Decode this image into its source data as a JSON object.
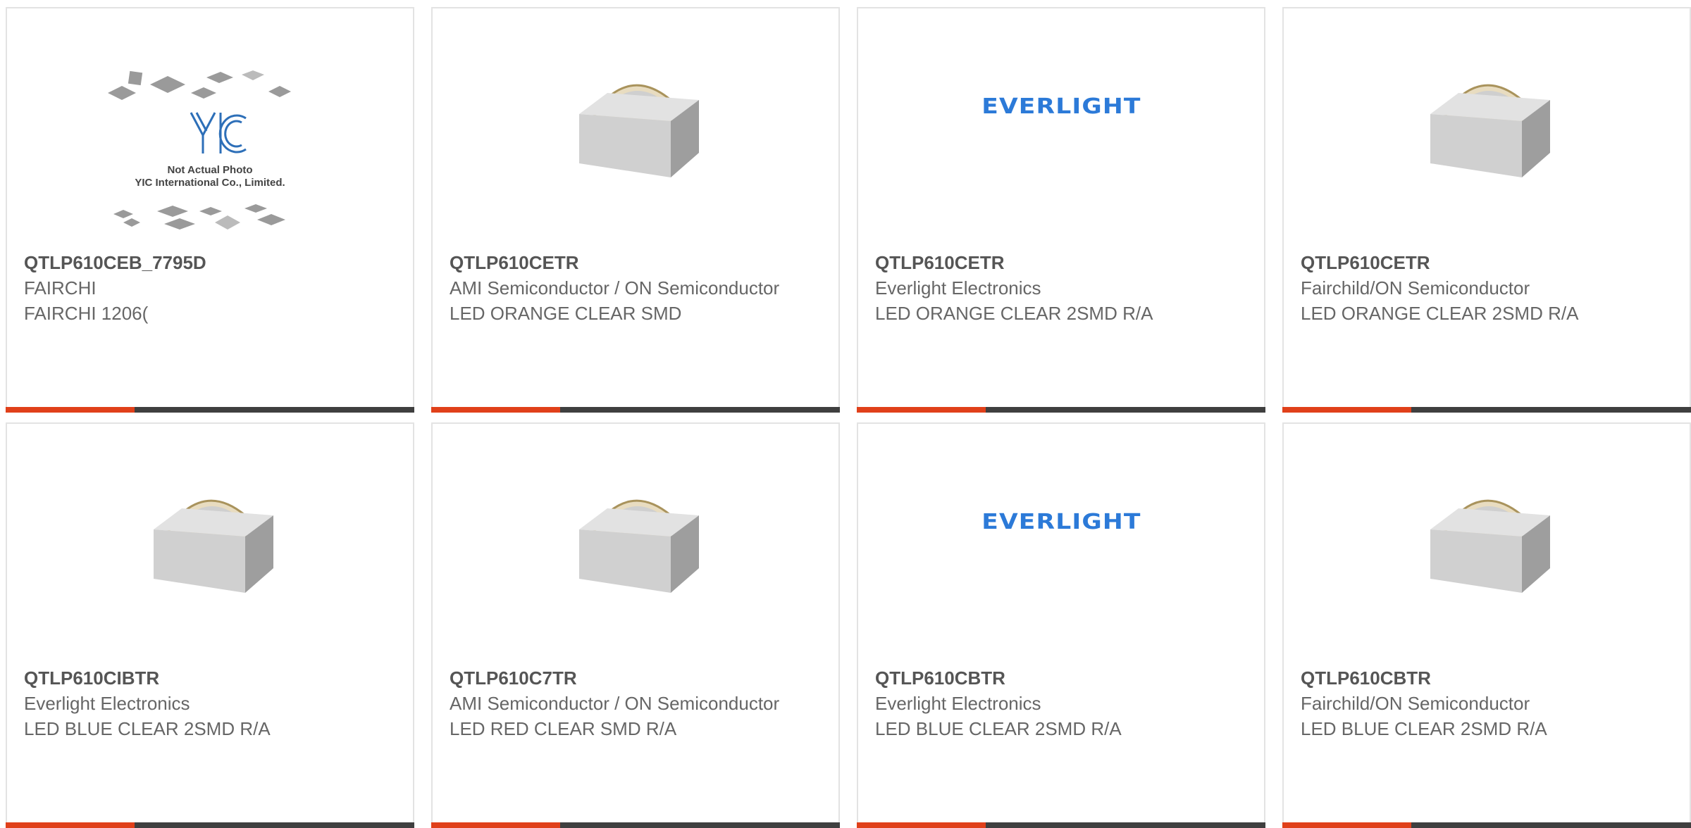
{
  "products": [
    {
      "part": "QTLP610CEB_7795D",
      "manufacturer": "FAIRCHI",
      "description": "FAIRCHI 1206(",
      "image": "yic-placeholder",
      "image_text": {
        "line1": "Not Actual Photo",
        "line2": "YIC International Co., Limited.",
        "logo": "YIC"
      }
    },
    {
      "part": "QTLP610CETR",
      "manufacturer": "AMI Semiconductor / ON Semiconductor",
      "description": "LED ORANGE CLEAR SMD",
      "image": "led-photo"
    },
    {
      "part": "QTLP610CETR",
      "manufacturer": "Everlight Electronics",
      "description": "LED ORANGE CLEAR 2SMD R/A",
      "image": "everlight-logo",
      "logo_text": "EVERLIGHT"
    },
    {
      "part": "QTLP610CETR",
      "manufacturer": "Fairchild/ON Semiconductor",
      "description": "LED ORANGE CLEAR 2SMD R/A",
      "image": "led-photo"
    },
    {
      "part": "QTLP610CIBTR",
      "manufacturer": "Everlight Electronics",
      "description": "LED BLUE CLEAR 2SMD R/A",
      "image": "led-photo"
    },
    {
      "part": "QTLP610C7TR",
      "manufacturer": "AMI Semiconductor / ON Semiconductor",
      "description": "LED RED CLEAR SMD R/A",
      "image": "led-photo"
    },
    {
      "part": "QTLP610CBTR",
      "manufacturer": "Everlight Electronics",
      "description": "LED BLUE CLEAR 2SMD R/A",
      "image": "everlight-logo",
      "logo_text": "EVERLIGHT"
    },
    {
      "part": "QTLP610CBTR",
      "manufacturer": "Fairchild/ON Semiconductor",
      "description": "LED BLUE CLEAR 2SMD R/A",
      "image": "led-photo"
    }
  ],
  "colors": {
    "accent": "#e0401a",
    "bar": "#3f3f3f",
    "border": "#e3e3e3",
    "logo_blue": "#2c7ad8",
    "text": "#666666"
  }
}
